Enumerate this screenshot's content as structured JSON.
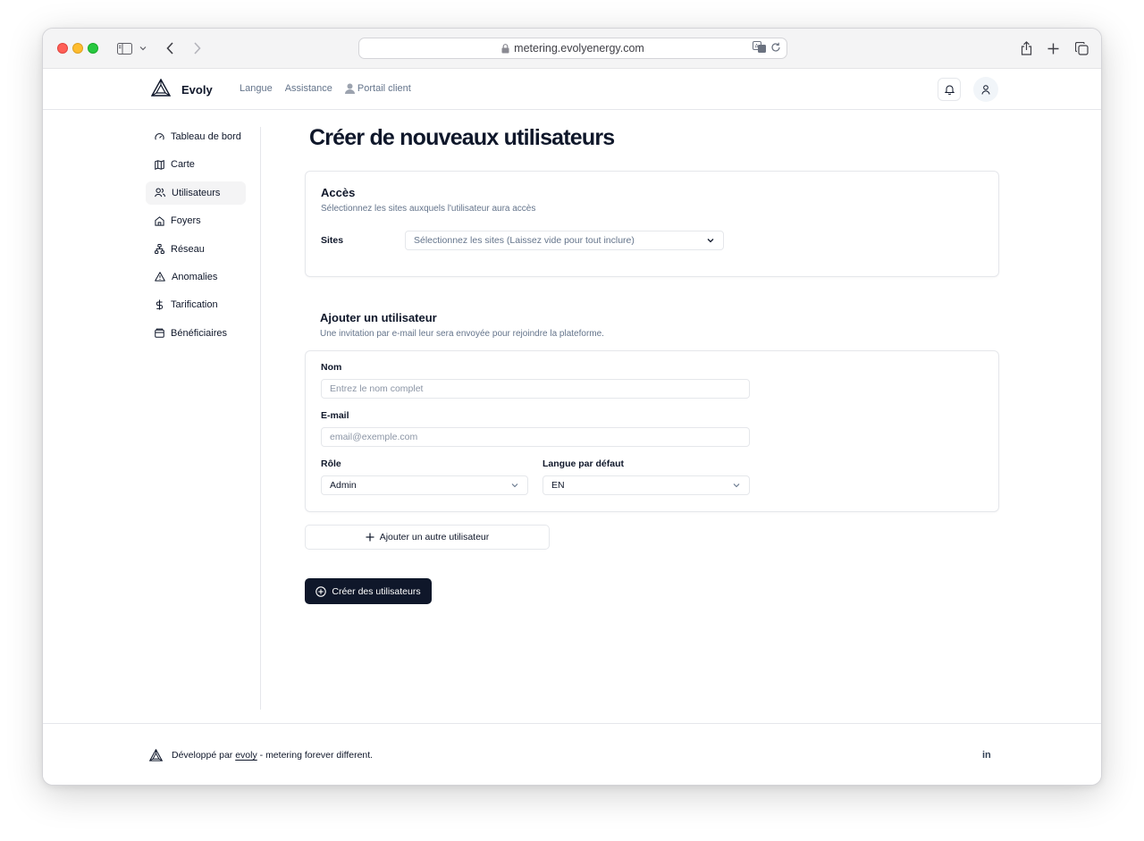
{
  "browser": {
    "url": "metering.evolyenergy.com"
  },
  "header": {
    "brand": "Evoly",
    "nav": {
      "language": "Langue",
      "support": "Assistance",
      "client_portal": "Portail client"
    }
  },
  "sidebar": {
    "items": [
      {
        "label": "Tableau de bord",
        "icon": "gauge-icon"
      },
      {
        "label": "Carte",
        "icon": "map-icon"
      },
      {
        "label": "Utilisateurs",
        "icon": "users-icon",
        "active": true
      },
      {
        "label": "Foyers",
        "icon": "home-icon"
      },
      {
        "label": "Réseau",
        "icon": "network-icon"
      },
      {
        "label": "Anomalies",
        "icon": "warning-icon"
      },
      {
        "label": "Tarification",
        "icon": "dollar-icon"
      },
      {
        "label": "Bénéficiaires",
        "icon": "wallet-icon"
      }
    ]
  },
  "main": {
    "title": "Créer de nouveaux utilisateurs",
    "access": {
      "title": "Accès",
      "subtitle": "Sélectionnez les sites auxquels l'utilisateur aura accès",
      "sites_label": "Sites",
      "sites_placeholder": "Sélectionnez les sites (Laissez vide pour tout inclure)"
    },
    "add_user": {
      "title": "Ajouter un utilisateur",
      "subtitle": "Une invitation par e-mail leur sera envoyée pour rejoindre la plateforme.",
      "name_label": "Nom",
      "name_placeholder": "Entrez le nom complet",
      "email_label": "E-mail",
      "email_placeholder": "email@exemple.com",
      "role_label": "Rôle",
      "role_value": "Admin",
      "language_label": "Langue par défaut",
      "language_value": "EN"
    },
    "add_another_button": "Ajouter un autre utilisateur",
    "create_button": "Créer des utilisateurs"
  },
  "footer": {
    "prefix": "Développé par ",
    "link": "evoly",
    "suffix": " - metering forever different.",
    "social": "in"
  }
}
